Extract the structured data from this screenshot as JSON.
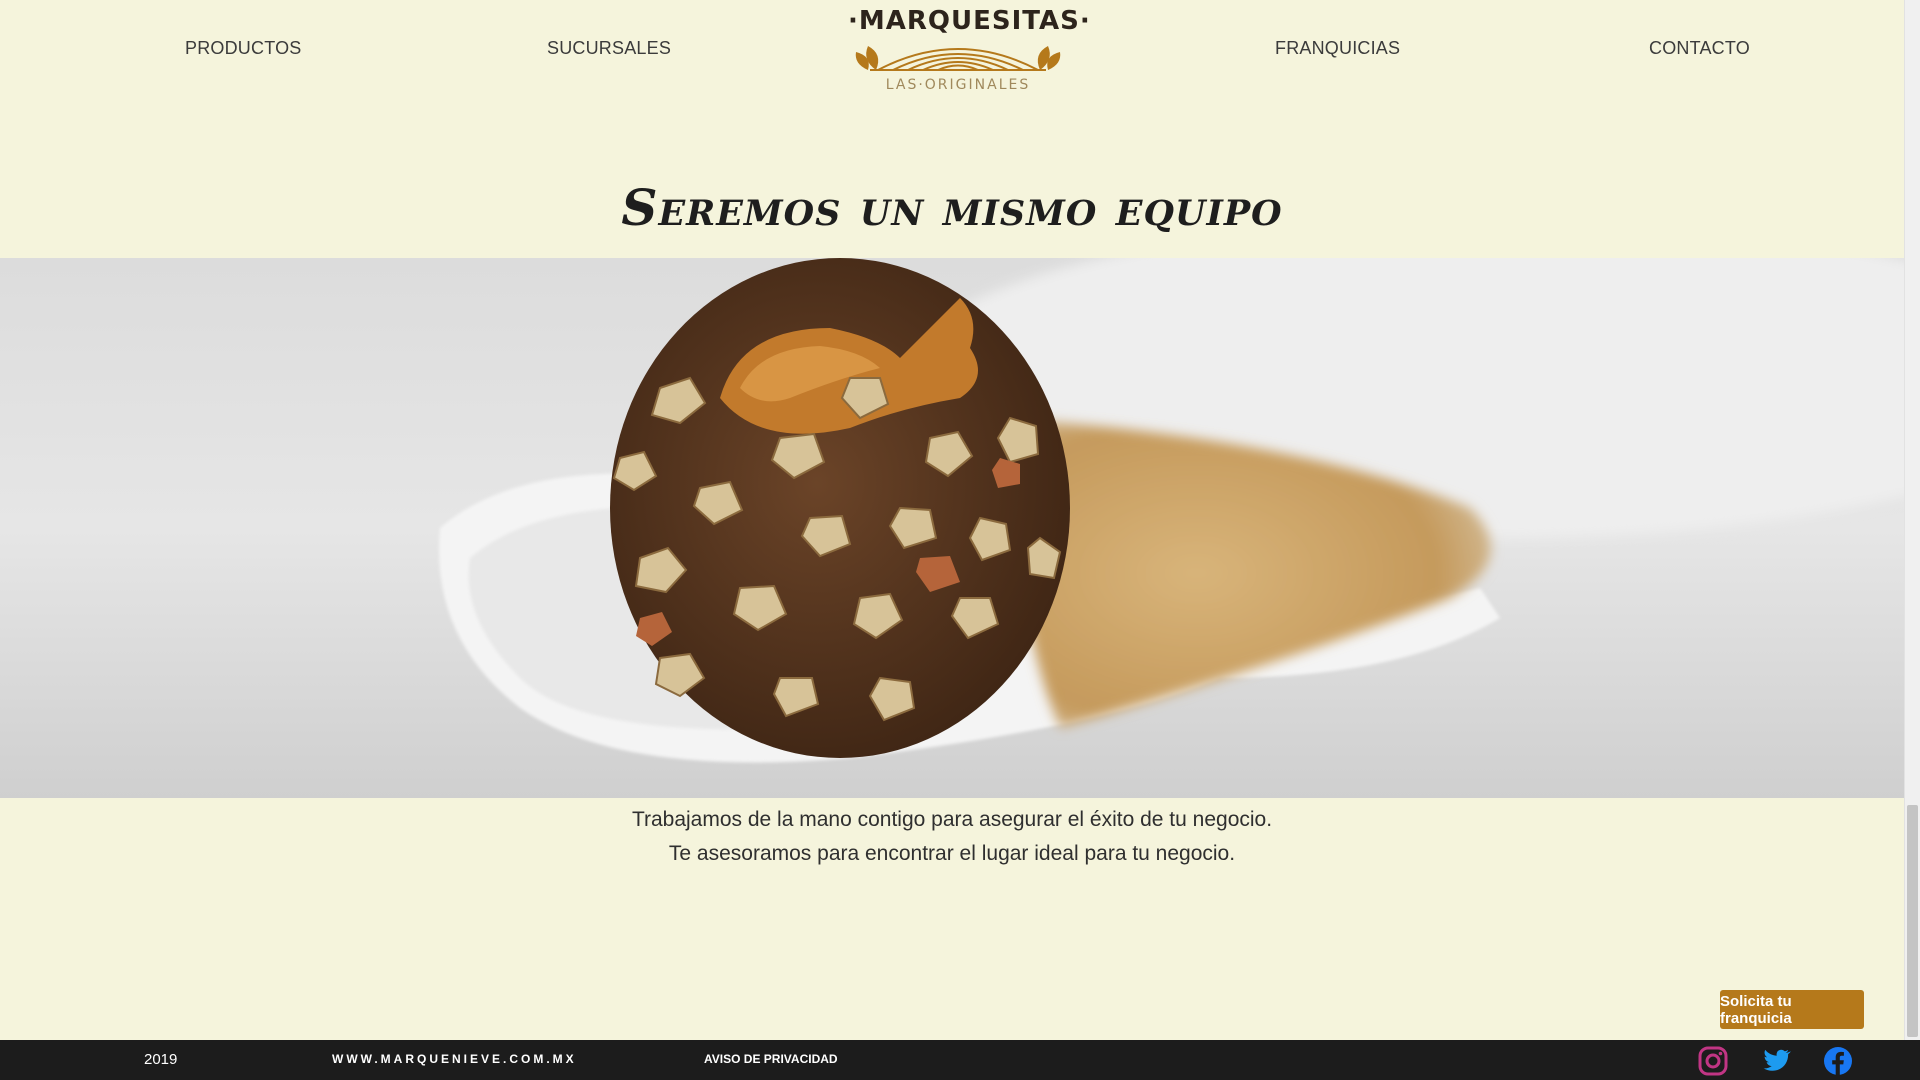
{
  "nav": {
    "productos": "PRODUCTOS",
    "sucursales": "SUCURSALES",
    "franquicias": "FRANQUICIAS",
    "contacto": "CONTACTO"
  },
  "logo": {
    "top": "·MARQUESITAS·",
    "bottom": "LAS·ORIGINALES"
  },
  "main": {
    "title": "Seremos un mismo equipo",
    "description_line1": "Trabajamos de la mano contigo para asegurar el éxito de tu negocio.",
    "description_line2": "Te asesoramos para encontrar el lugar ideal para tu negocio."
  },
  "cta": {
    "label": "Solicita tu franquicia"
  },
  "footer": {
    "year": "2019",
    "site": "WWW.MARQUENIEVE.COM.MX",
    "privacy": "AVISO DE PRIVACIDAD",
    "social": [
      "instagram-icon",
      "twitter-icon",
      "facebook-icon"
    ]
  },
  "colors": {
    "background": "#f5f4dc",
    "accent": "#b5791b",
    "footer": "#1c1c1c",
    "instagram": "#c13584",
    "twitter": "#1d9bf0",
    "facebook": "#1877f2"
  }
}
